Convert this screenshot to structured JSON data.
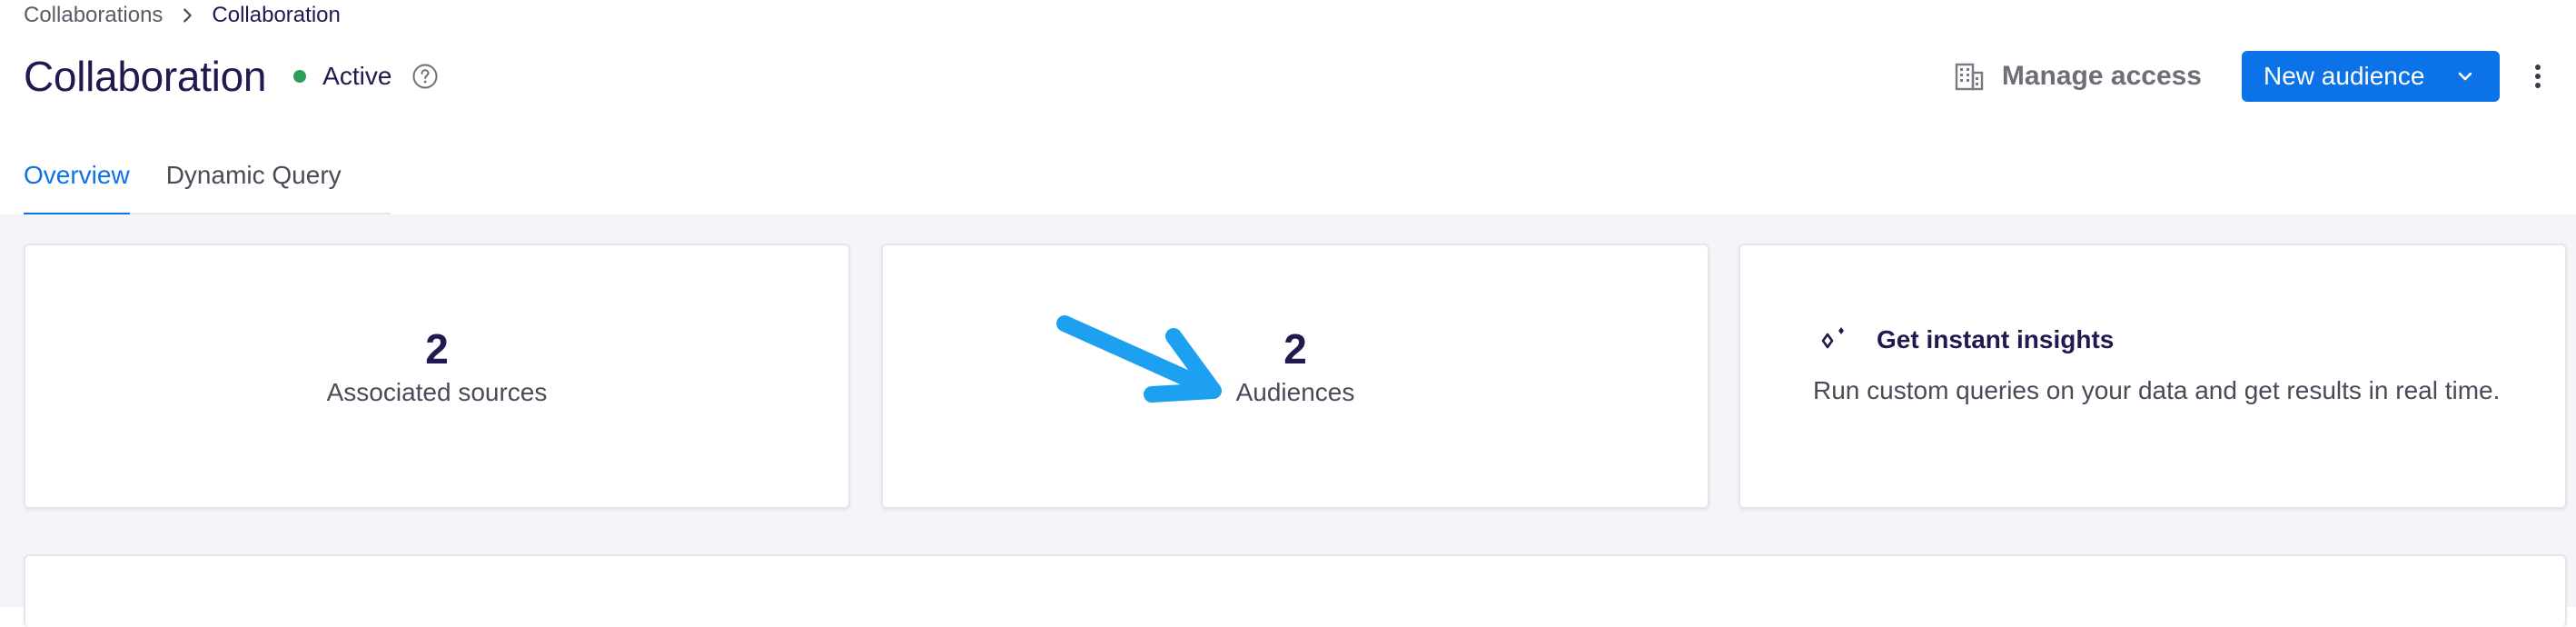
{
  "breadcrumb": {
    "parent": "Collaborations",
    "current": "Collaboration"
  },
  "header": {
    "title": "Collaboration",
    "status": "Active",
    "status_color": "#2e9e5b",
    "manage_access": "Manage access",
    "new_audience": "New audience"
  },
  "tabs": [
    {
      "label": "Overview",
      "active": true
    },
    {
      "label": "Dynamic Query",
      "active": false
    }
  ],
  "cards": {
    "sources": {
      "value": "2",
      "label": "Associated sources"
    },
    "audiences": {
      "value": "2",
      "label": "Audiences"
    },
    "insights": {
      "title": "Get instant insights",
      "description": "Run custom queries on your data and get results in real time."
    }
  },
  "colors": {
    "accent": "#0b72e7",
    "annotation_arrow": "#1ea0f0",
    "title": "#1f1a4f"
  },
  "icons": [
    "chevron-right-icon",
    "help-circle-icon",
    "building-icon",
    "chevron-down-icon",
    "more-vertical-icon",
    "sparkle-icon",
    "annotation-arrow-icon"
  ]
}
